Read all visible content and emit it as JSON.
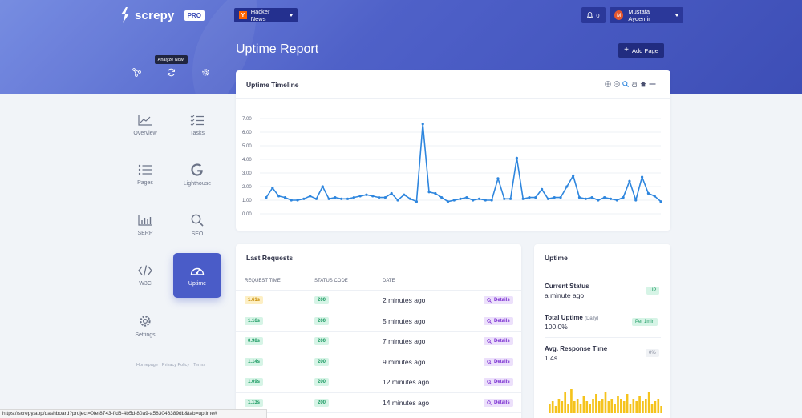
{
  "app": {
    "name": "screpy",
    "badge": "PRO"
  },
  "header": {
    "project_label": "Hacker News",
    "project_icon_letter": "Y",
    "notifications_count": "0",
    "user_name": "Mustafa Aydemir",
    "user_initial": "M"
  },
  "toolbar": {
    "tooltip": "Analyze Now!",
    "icons": [
      "sitemap-icon",
      "refresh-icon",
      "gear-icon"
    ]
  },
  "page": {
    "title": "Uptime Report",
    "add_page_label": "Add Page"
  },
  "sidebar": {
    "items": [
      {
        "label": "Overview",
        "icon": "trend-chart-icon"
      },
      {
        "label": "Tasks",
        "icon": "checklist-icon"
      },
      {
        "label": "Pages",
        "icon": "list-icon"
      },
      {
        "label": "Lighthouse",
        "icon": "google-g-icon"
      },
      {
        "label": "SERP",
        "icon": "bar-chart-icon"
      },
      {
        "label": "SEO",
        "icon": "search-icon"
      },
      {
        "label": "W3C",
        "icon": "code-icon"
      },
      {
        "label": "Uptime",
        "icon": "gauge-icon",
        "active": true
      },
      {
        "label": "Settings",
        "icon": "gear-icon"
      }
    ],
    "footer_links": [
      "Homepage",
      "Privacy Policy",
      "Terms"
    ]
  },
  "timeline": {
    "title": "Uptime Timeline",
    "tools": [
      "zoom-in-icon",
      "zoom-out-icon",
      "magnifier-icon",
      "pan-hand-icon",
      "home-icon",
      "menu-icon"
    ]
  },
  "chart_data": {
    "type": "line",
    "title": "Uptime Timeline",
    "ylim": [
      0,
      7
    ],
    "yticks": [
      "0.00",
      "1.00",
      "2.00",
      "3.00",
      "4.00",
      "5.00",
      "6.00",
      "7.00"
    ],
    "grid": true,
    "color": "#2e86de",
    "values": [
      1.2,
      1.9,
      1.3,
      1.2,
      1.0,
      1.0,
      1.1,
      1.3,
      1.1,
      2.0,
      1.1,
      1.2,
      1.1,
      1.1,
      1.2,
      1.3,
      1.4,
      1.3,
      1.2,
      1.2,
      1.5,
      1.0,
      1.4,
      1.1,
      0.9,
      6.6,
      1.6,
      1.5,
      1.2,
      0.9,
      1.0,
      1.1,
      1.2,
      1.0,
      1.1,
      1.0,
      1.0,
      2.6,
      1.1,
      1.1,
      4.1,
      1.1,
      1.2,
      1.2,
      1.8,
      1.1,
      1.2,
      1.2,
      2.0,
      2.8,
      1.2,
      1.1,
      1.2,
      1.0,
      1.2,
      1.1,
      1.0,
      1.2,
      2.4,
      1.0,
      2.7,
      1.5,
      1.3,
      0.9
    ]
  },
  "requests": {
    "title": "Last Requests",
    "columns": [
      "REQUEST TIME",
      "STATUS CODE",
      "DATE"
    ],
    "rows": [
      {
        "time": "1.61s",
        "warn": true,
        "code": "200",
        "date": "2 minutes ago",
        "action": "Details"
      },
      {
        "time": "1.16s",
        "warn": false,
        "code": "200",
        "date": "5 minutes ago",
        "action": "Details"
      },
      {
        "time": "0.98s",
        "warn": false,
        "code": "200",
        "date": "7 minutes ago",
        "action": "Details"
      },
      {
        "time": "1.14s",
        "warn": false,
        "code": "200",
        "date": "9 minutes ago",
        "action": "Details"
      },
      {
        "time": "1.09s",
        "warn": false,
        "code": "200",
        "date": "12 minutes ago",
        "action": "Details"
      },
      {
        "time": "1.13s",
        "warn": false,
        "code": "200",
        "date": "14 minutes ago",
        "action": "Details"
      }
    ]
  },
  "uptime": {
    "title": "Uptime",
    "current_status": {
      "label": "Current Status",
      "value": "a minute ago",
      "pill": "UP"
    },
    "total_uptime": {
      "label": "Total Uptime",
      "sub": "(Daily)",
      "value": "100.0%",
      "pill": "Per 1min"
    },
    "avg_response": {
      "label": "Avg. Response Time",
      "value": "1.4s",
      "pill": "0%"
    },
    "mini_bars": [
      0.4,
      0.5,
      0.3,
      0.6,
      0.5,
      0.9,
      0.4,
      1.0,
      0.5,
      0.6,
      0.4,
      0.7,
      0.5,
      0.4,
      0.6,
      0.8,
      0.5,
      0.6,
      0.9,
      0.5,
      0.6,
      0.4,
      0.7,
      0.6,
      0.5,
      0.8,
      0.4,
      0.6,
      0.5,
      0.7,
      0.5,
      0.6,
      0.9,
      0.4,
      0.5,
      0.6,
      0.3
    ],
    "bar_color": "#f5c31c"
  },
  "statusbar": {
    "url": "https://screpy.app/dashboard?project=0fef8743-ffd6-4b5d-80a9-a583046389db&tab=uptime#"
  }
}
